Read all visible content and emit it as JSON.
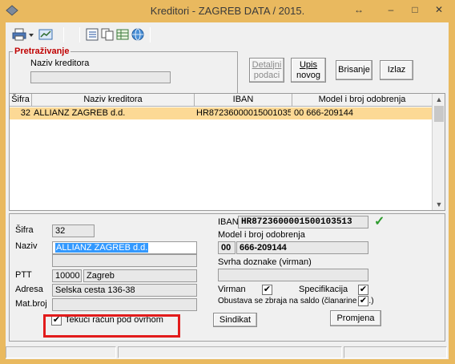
{
  "window": {
    "title": "Kreditori - ZAGREB DATA  /  2015.",
    "restore_glyph": "↔",
    "minimize_glyph": "–",
    "maximize_glyph": "□",
    "close_glyph": "✕"
  },
  "search": {
    "group_title": "Pretraživanje",
    "name_label": "Naziv kreditora",
    "name_value": ""
  },
  "buttons": {
    "details_line1": "Detaljni",
    "details_line2": "podaci",
    "new_line1": "Upis",
    "new_line2": "novog",
    "delete": "Brisanje",
    "exit": "Izlaz",
    "syndicate": "Sindikat",
    "change": "Promjena"
  },
  "grid": {
    "columns": [
      "Šifra",
      "Naziv kreditora",
      "IBAN",
      "Model i broj odobrenja"
    ],
    "rows": [
      {
        "sifra": "32",
        "naziv": "ALLIANZ ZAGREB d.d.",
        "iban": "HR8723600001500103513",
        "model": "00 666-209144"
      }
    ]
  },
  "detail": {
    "sifra_label": "Šifra",
    "sifra_value": "32",
    "naziv_label": "Naziv",
    "naziv_value": "ALLIANZ ZAGREB d.d.",
    "naziv_value2": "",
    "ptt_label": "PTT",
    "ptt_code": "10000",
    "ptt_city": "Zagreb",
    "adresa_label": "Adresa",
    "adresa_value": "Selska cesta 136-38",
    "matbroj_label": "Mat.broj",
    "matbroj_value": "",
    "iban_label": "IBAN",
    "iban_value": "HR8723600001500103513",
    "iban_valid_glyph": "✓",
    "model_label": "Model i broj odobrenja",
    "model_code": "00",
    "model_number": "666-209144",
    "svrha_label": "Svrha doznake (virman)",
    "svrha_value": "",
    "virman_label": "Virman",
    "virman_checked": "✔",
    "spec_label": "Specifikacija",
    "spec_checked": "✔",
    "obustava_label": "Obustava se zbraja na saldo (članarine i sl.)",
    "obustava_checked": "✔",
    "tekuci_label": "Tekući račun pod ovrhom",
    "tekuci_checked": "✔"
  },
  "colors": {
    "title_bar": "#e9b95f",
    "selected_row": "#fcd995",
    "group_title": "#c00000",
    "highlight_box": "#e21b1b",
    "valid_check": "#2e9b2e"
  }
}
